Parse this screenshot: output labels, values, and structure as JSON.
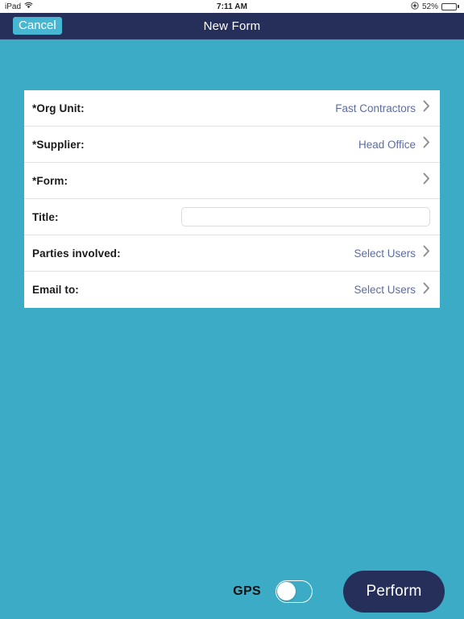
{
  "status_bar": {
    "device_name": "iPad",
    "wifi_icon": "wifi-icon",
    "time": "7:11 AM",
    "location_icon": "location-services-icon",
    "battery_percent": "52%",
    "battery_level": 52
  },
  "nav_bar": {
    "cancel_label": "Cancel",
    "title": "New Form",
    "background_color": "#252f5a",
    "cancel_highlight_color": "#47b6d2"
  },
  "theme": {
    "page_background": "#3cabc6",
    "accent_navy": "#252f5a",
    "value_text_color": "#5c6ca0",
    "chevron_color": "#8e8e93"
  },
  "form": {
    "rows": [
      {
        "label": "*Org Unit:",
        "value": "Fast Contractors",
        "type": "disclosure",
        "chevron": true,
        "name": "org-unit"
      },
      {
        "label": "*Supplier:",
        "value": "Head Office",
        "type": "disclosure",
        "chevron": true,
        "name": "supplier"
      },
      {
        "label": "*Form:",
        "value": "",
        "type": "disclosure",
        "chevron": true,
        "name": "form"
      },
      {
        "label": "Title:",
        "value": "",
        "placeholder": "",
        "type": "text-input",
        "chevron": false,
        "name": "title"
      },
      {
        "label": "Parties involved:",
        "value": "Select Users",
        "type": "disclosure",
        "chevron": true,
        "name": "parties-involved"
      },
      {
        "label": "Email to:",
        "value": "Select Users",
        "type": "disclosure",
        "chevron": true,
        "name": "email-to"
      }
    ]
  },
  "bottom_bar": {
    "gps_label": "GPS",
    "gps_enabled": false,
    "perform_label": "Perform"
  }
}
